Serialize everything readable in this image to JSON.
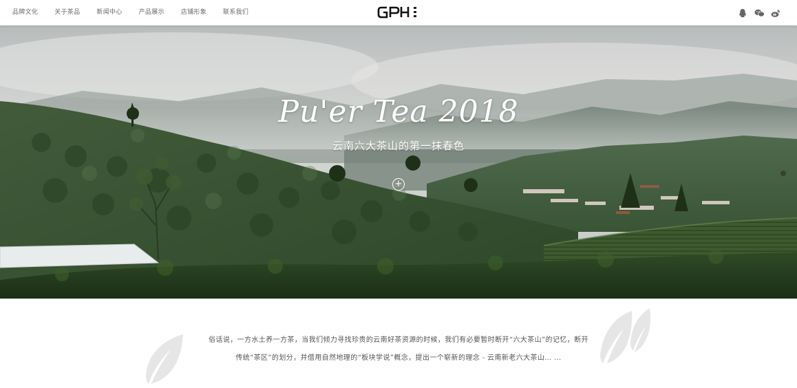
{
  "nav": {
    "items": [
      "品牌文化",
      "关于茶品",
      "新闻中心",
      "产品展示",
      "店铺形象",
      "联系我们"
    ]
  },
  "logo": {
    "text": "GPH",
    "side_text": "茶品汇"
  },
  "social": {
    "icons": [
      "qq-icon",
      "wechat-icon",
      "weibo-icon"
    ]
  },
  "hero": {
    "title": "Pu'er Tea 2018",
    "subtitle": "云南六大茶山的第一抹春色",
    "more_label": "+"
  },
  "intro": {
    "line1": "俗话说，一方水土养一方茶，当我们倾力寻找珍贵的云南好茶资源的时候，我们有必要暂时断开“六大茶山”的记忆，断开",
    "line2": "传统“茶区”的划分，并借用自然地理的“板块学说”概念，提出一个崭新的理念 - 云南新老六大茶山… …"
  },
  "colors": {
    "nav_text": "#6a6a6a",
    "body_text": "#555555",
    "hero_text": "#ffffff",
    "leaf": "#e6e6e6"
  }
}
